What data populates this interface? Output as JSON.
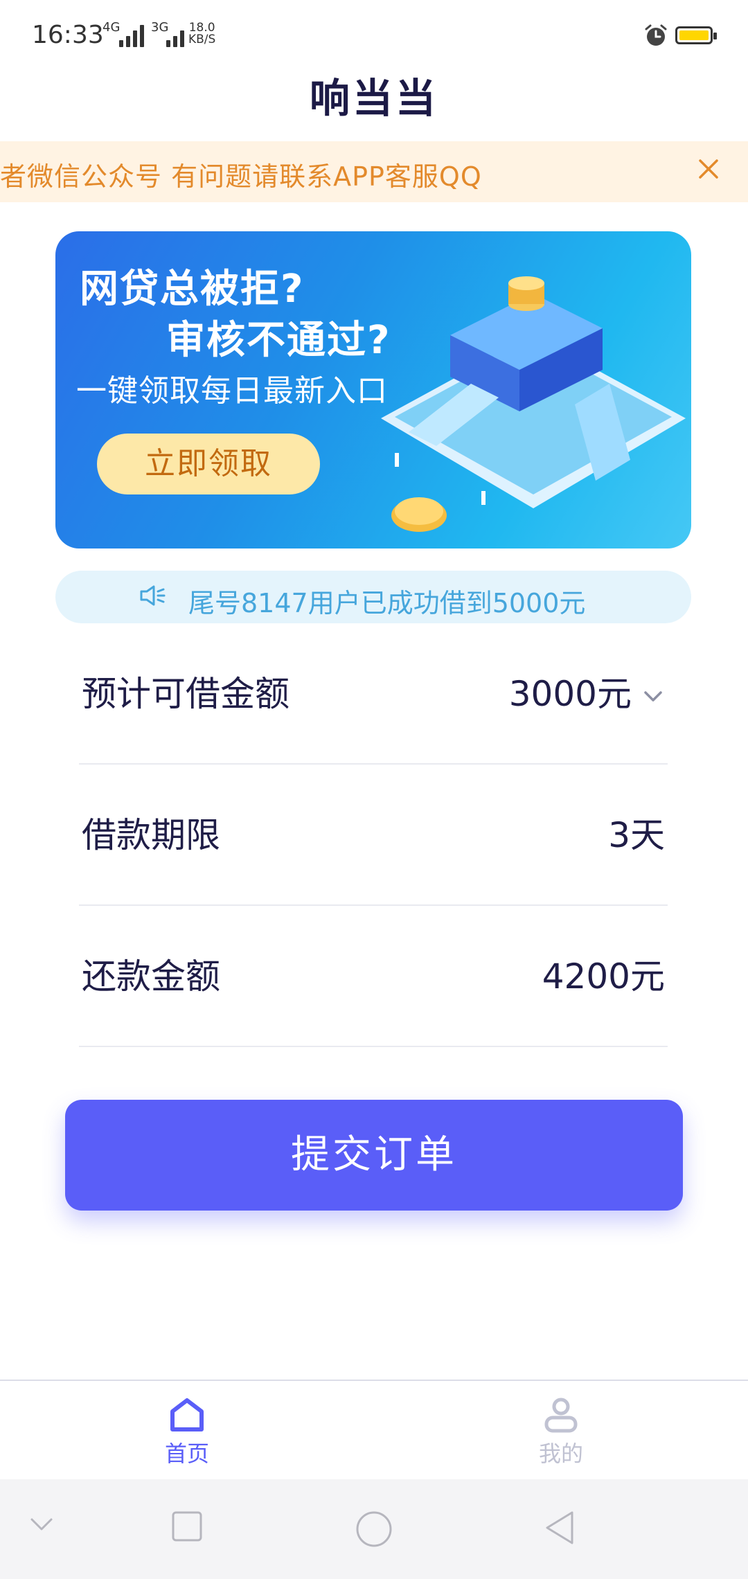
{
  "status_bar": {
    "time": "16:33",
    "net1": "4G",
    "net2": "3G",
    "speed_value": "18.0",
    "speed_unit": "KB/S"
  },
  "header": {
    "title": "响当当"
  },
  "notice": {
    "text": "者微信公众号  有问题请联系APP客服QQ"
  },
  "banner": {
    "line1": "网贷总被拒?",
    "line2": "审核不通过?",
    "line3": "一键领取每日最新入口",
    "button": "立即领取"
  },
  "broadcast": {
    "text": "尾号8147用户已成功借到5000元"
  },
  "rows": [
    {
      "label": "预计可借金额",
      "value": "3000元"
    },
    {
      "label": "借款期限",
      "value": "3天"
    },
    {
      "label": "还款金额",
      "value": "4200元"
    }
  ],
  "submit": {
    "label": "提交订单"
  },
  "tabbar": {
    "tabs": [
      {
        "label": "首页",
        "active": true
      },
      {
        "label": "我的",
        "active": false
      }
    ]
  },
  "colors": {
    "accent": "#5a5ef8",
    "notice_text": "#e38a2c",
    "broadcast_text": "#46a6dc",
    "inactive_tab": "#c0c2d2"
  }
}
